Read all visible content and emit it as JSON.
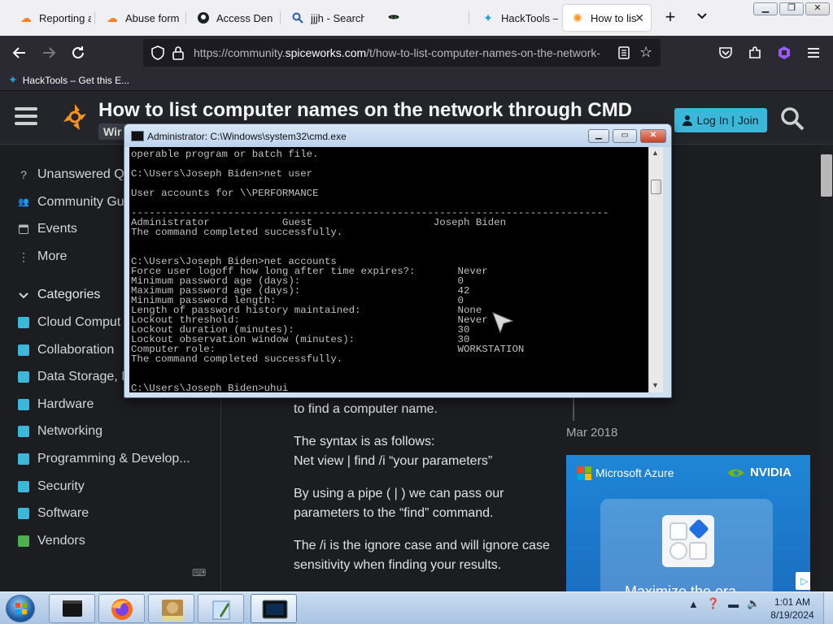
{
  "browser": {
    "tabs": [
      {
        "label": "Reporting ab",
        "icon": "cloudflare-icon"
      },
      {
        "label": "Abuse form |",
        "icon": "cloudflare-icon"
      },
      {
        "label": "Access Denie",
        "icon": "github-icon"
      },
      {
        "label": "jjjh - Search",
        "icon": "search-icon"
      },
      {
        "label": "HackTools – (",
        "icon": "hacktools-icon"
      },
      {
        "label": "How to list",
        "icon": "spiceworks-icon"
      }
    ],
    "url_prefix": "https://community.",
    "url_domain": "spiceworks.com",
    "url_rest": "/t/how-to-list-computer-names-on-the-network-",
    "bookmark": "HackTools – Get this E..."
  },
  "page": {
    "title": "How to list computer names on the network through CMD",
    "tag": "Wir",
    "login_label": "Log In | Join",
    "sidebar": {
      "nav": [
        {
          "label": "Unanswered Q",
          "icon": "question-icon"
        },
        {
          "label": "Community Gu",
          "icon": "people-icon"
        },
        {
          "label": "Events",
          "icon": "calendar-icon"
        },
        {
          "label": "More",
          "icon": "more-icon"
        }
      ],
      "categories_heading": "Categories",
      "categories": [
        {
          "label": "Cloud Comput",
          "color": "#3ab7d9"
        },
        {
          "label": "Collaboration",
          "color": "#3ab7d9"
        },
        {
          "label": "Data Storage, I",
          "color": "#3ab7d9"
        },
        {
          "label": "Hardware",
          "color": "#3ab7d9"
        },
        {
          "label": "Networking",
          "color": "#3ab7d9"
        },
        {
          "label": "Programming & Develop...",
          "color": "#3ab7d9"
        },
        {
          "label": "Security",
          "color": "#3ab7d9"
        },
        {
          "label": "Software",
          "color": "#3ab7d9"
        },
        {
          "label": "Vendors",
          "color": "#4caf50"
        }
      ],
      "keyboard_icon": "⌨"
    },
    "post": {
      "p1": "to find a computer name.",
      "p2_line1": "The syntax is as follows:",
      "p2_line2": "Net view | find /i “your parameters”",
      "p3": "By using a pipe ( | ) we can pass our parameters to the “find” command.",
      "p4": "The /i is the ignore case and will ignore case sensitivity when finding your results."
    },
    "timeline_date": "Mar 2018",
    "ad": {
      "microsoft": "Microsoft Azure",
      "nvidia": "NVIDIA",
      "headline": "Maximize the era"
    }
  },
  "cmd": {
    "title": "Administrator: C:\\Windows\\system32\\cmd.exe",
    "lines": [
      "operable program or batch file.",
      "",
      "C:\\Users\\Joseph Biden>net user",
      "",
      "User accounts for \\\\PERFORMANCE",
      "",
      "-------------------------------------------------------------------------------",
      "Administrator            Guest                    Joseph Biden",
      "The command completed successfully.",
      "",
      "",
      "C:\\Users\\Joseph Biden>net accounts",
      "Force user logoff how long after time expires?:       Never",
      "Minimum password age (days):                          0",
      "Maximum password age (days):                          42",
      "Minimum password length:                              0",
      "Length of password history maintained:                None",
      "Lockout threshold:                                    Never",
      "Lockout duration (minutes):                           30",
      "Lockout observation window (minutes):                 30",
      "Computer role:                                        WORKSTATION",
      "The command completed successfully.",
      "",
      "",
      "C:\\Users\\Joseph Biden>uhui"
    ]
  },
  "taskbar": {
    "time": "1:01 AM",
    "date": "8/19/2024",
    "apps": [
      "explorer",
      "firefox",
      "sandboxie",
      "notepad",
      "cmd"
    ]
  }
}
